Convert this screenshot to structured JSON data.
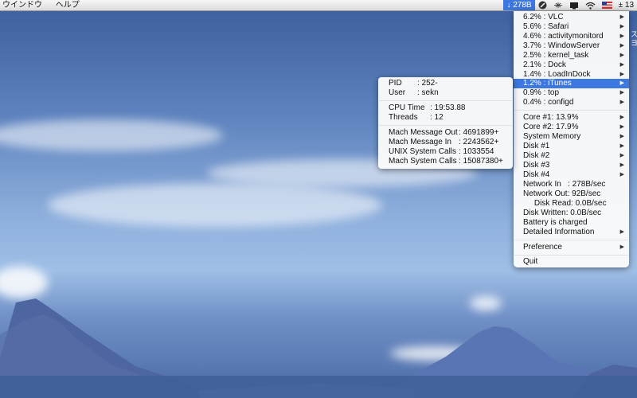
{
  "menubar": {
    "left": [
      "ウインドウ",
      "ヘルプ"
    ],
    "status_item": "↓ 278B",
    "clock": "± 13"
  },
  "desktop_edge_text": "ス ヨ",
  "main_menu": {
    "processes": [
      {
        "label": "6.2% : VLC"
      },
      {
        "label": "5.6% : Safari"
      },
      {
        "label": "4.6% : activitymonitord"
      },
      {
        "label": "3.7% : WindowServer"
      },
      {
        "label": "2.5% : kernel_task"
      },
      {
        "label": "2.1% : Dock"
      },
      {
        "label": "1.4% : LoadInDock"
      },
      {
        "label": "1.2% : iTunes"
      },
      {
        "label": "0.9% : top"
      },
      {
        "label": "0.4% : configd"
      }
    ],
    "hardware": [
      {
        "label": "Core #1: 13.9%"
      },
      {
        "label": "Core #2: 17.9%"
      },
      {
        "label": "System Memory"
      },
      {
        "label": "Disk #1"
      },
      {
        "label": "Disk #2"
      },
      {
        "label": "Disk #3"
      },
      {
        "label": "Disk #4"
      }
    ],
    "stats": [
      {
        "label": "Network In   : 278B/sec"
      },
      {
        "label": "Network Out: 92B/sec"
      },
      {
        "label": "     Disk Read: 0.0B/sec"
      },
      {
        "label": "Disk Written: 0.0B/sec"
      },
      {
        "label": "Battery is charged"
      },
      {
        "label": "Detailed Information"
      }
    ],
    "preference": "Preference",
    "quit": "Quit"
  },
  "submenu": {
    "pid_label": "PID",
    "pid_value": ": 252-",
    "user_label": "User",
    "user_value": ": sekn",
    "cpu_label": "CPU Time",
    "cpu_value": ": 19:53.88",
    "threads_label": "Threads",
    "threads_value": ": 12",
    "mmo_label": "Mach Message Out",
    "mmo_value": ": 4691899+",
    "mmi_label": "Mach Message In",
    "mmi_value": ": 2243562+",
    "usc_label": "UNIX System Calls",
    "usc_value": ": 1033554",
    "msc_label": "Mach System Calls",
    "msc_value": ": 15087380+"
  },
  "colors": {
    "highlight": "#3d77e0",
    "sky": "#5f84bf"
  }
}
